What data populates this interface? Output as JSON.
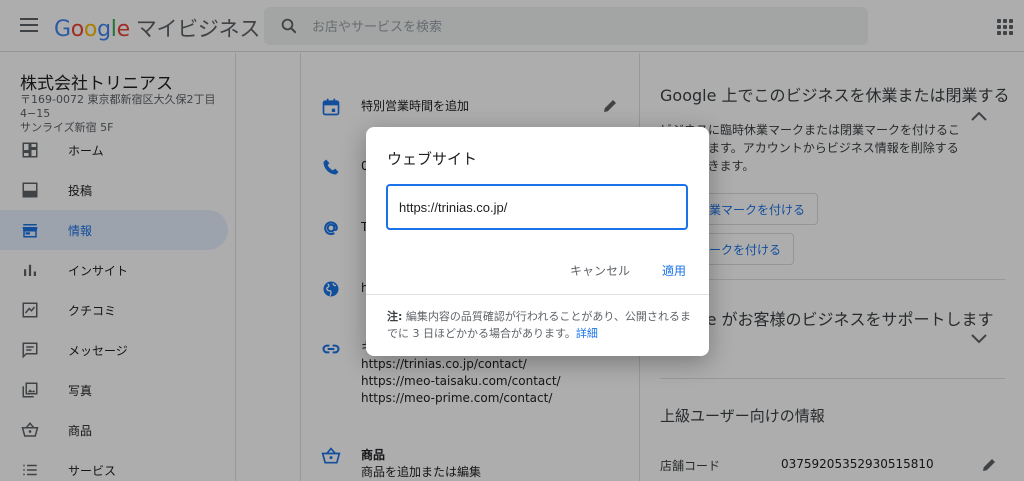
{
  "header": {
    "logo_google": [
      "G",
      "o",
      "o",
      "g",
      "l",
      "e"
    ],
    "product_name": "マイビジネス",
    "search_placeholder": "お店やサービスを検索"
  },
  "business": {
    "name": "株式会社トリニアス",
    "address_line1": "〒169-0072 東京都新宿区大久保2丁目4−15",
    "address_line2": "サンライズ新宿 5F"
  },
  "sidebar": {
    "items": [
      {
        "label": "ホーム",
        "icon": "dashboard-icon"
      },
      {
        "label": "投稿",
        "icon": "post-icon"
      },
      {
        "label": "情報",
        "icon": "store-icon",
        "active": true
      },
      {
        "label": "インサイト",
        "icon": "bar-chart-icon"
      },
      {
        "label": "クチコミ",
        "icon": "review-icon"
      },
      {
        "label": "メッセージ",
        "icon": "message-icon"
      },
      {
        "label": "写真",
        "icon": "photo-icon"
      },
      {
        "label": "商品",
        "icon": "basket-icon"
      },
      {
        "label": "サービス",
        "icon": "list-icon"
      }
    ]
  },
  "main": {
    "special_hours_label": "特別営業時間を追加",
    "phone_partial": "0",
    "at_partial": "T",
    "web_partial": "h",
    "link_partial": "キ",
    "urls": [
      "https://trinias.co.jp/contact/",
      "https://meo-taisaku.com/contact/",
      "https://meo-prime.com/contact/"
    ],
    "products_title": "商品",
    "products_sub": "商品を追加または編集"
  },
  "right": {
    "close_title": "Google 上でこのビジネスを休業または閉業する",
    "close_text": "ビジネスに臨時休業マークまたは閉業マークを付けることができます。アカウントからビジネス情報を削除することもできます。",
    "temp_close_btn": "臨時休業マークを付ける",
    "close_btn": "閉業マークを付ける",
    "support_title": "Google がお客様のビジネスをサポートします",
    "advanced_title": "上級ユーザー向けの情報",
    "store_code_label": "店舗コード",
    "store_code_value": "03759205352930515810"
  },
  "dialog": {
    "title": "ウェブサイト",
    "input_value": "https://trinias.co.jp/",
    "cancel_label": "キャンセル",
    "apply_label": "適用",
    "note_prefix": "注:",
    "note_text": " 編集内容の品質確認が行われることがあり、公開されるまでに 3 日ほどかかる場合があります。",
    "note_link": "詳細"
  },
  "colors": {
    "accent": "#1a73e8",
    "overlay": "rgba(0,0,0,0.32)"
  }
}
